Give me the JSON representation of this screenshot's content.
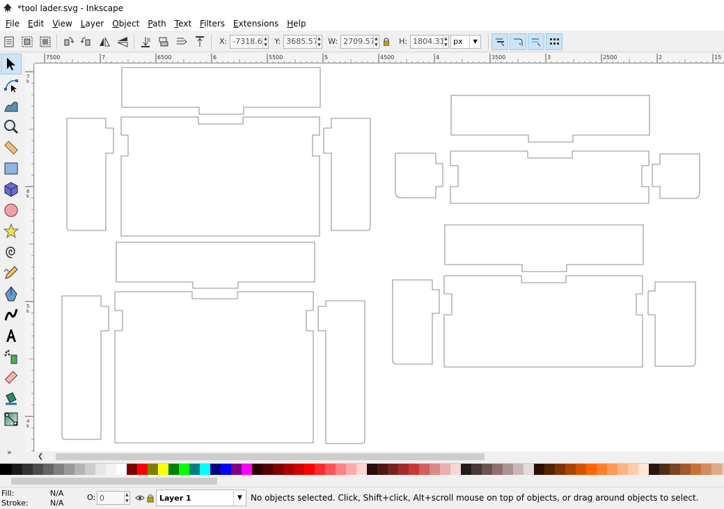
{
  "window": {
    "title": "*tool lader.svg - Inkscape"
  },
  "menu": [
    "File",
    "Edit",
    "View",
    "Layer",
    "Object",
    "Path",
    "Text",
    "Filters",
    "Extensions",
    "Help"
  ],
  "toolcontrols": {
    "x_label": "X:",
    "x_value": "-7318.6",
    "y_label": "Y:",
    "y_value": "3685.57",
    "w_label": "W:",
    "w_value": "2709.57",
    "h_label": "H:",
    "h_value": "1804.31",
    "unit": "px"
  },
  "ruler": {
    "h_labels": [
      "7500",
      "7",
      "6500",
      "6",
      "5500",
      "5",
      "4500",
      "4",
      "3500",
      "3",
      "2500",
      "2",
      "15"
    ],
    "v_labels": [
      "7",
      "k",
      "6",
      "k",
      "5",
      "k",
      "4",
      "k"
    ]
  },
  "toolbox_more": "»",
  "palette": {
    "colors": [
      "#000000",
      "#1a1a1a",
      "#333333",
      "#4d4d4d",
      "#666666",
      "#808080",
      "#999999",
      "#b3b3b3",
      "#cccccc",
      "#e6e6e6",
      "#f2f2f2",
      "#ffffff",
      "#800000",
      "#ff0000",
      "#808000",
      "#ffff00",
      "#008000",
      "#00ff00",
      "#008080",
      "#00ffff",
      "#000080",
      "#0000ff",
      "#800080",
      "#ff00ff",
      "#2b0000",
      "#550000",
      "#800000",
      "#aa0000",
      "#d40000",
      "#ff0000",
      "#ff2a2a",
      "#ff5555",
      "#ff8080",
      "#ffaaaa",
      "#ffd5d5",
      "#280b0b",
      "#501616",
      "#782121",
      "#a02c2c",
      "#c83737",
      "#d35f5f",
      "#de8787",
      "#e9afaf",
      "#f4d7d7",
      "#241c1c",
      "#483737",
      "#6c5353",
      "#916f6f",
      "#ac9393",
      "#c8b7b7",
      "#e3dbdb",
      "#2b1100",
      "#552200",
      "#803300",
      "#aa4400",
      "#d45500",
      "#ff6600",
      "#ff7f2a",
      "#ff9955",
      "#ffb380",
      "#ffccaa",
      "#ffe6d5",
      "#28170b",
      "#502d16",
      "#784421",
      "#a05a2c",
      "#c87137",
      "#d38d5f",
      "#deaa87",
      "#e9c6af"
    ]
  },
  "status": {
    "fill_label": "Fill:",
    "fill_value": "N/A",
    "stroke_label": "Stroke:",
    "stroke_value": "N/A",
    "opacity_label": "O:",
    "opacity_value": "0",
    "layer": "Layer 1",
    "message": "No objects selected. Click, Shift+click, Alt+scroll mouse on top of objects, or drag around objects to select."
  }
}
